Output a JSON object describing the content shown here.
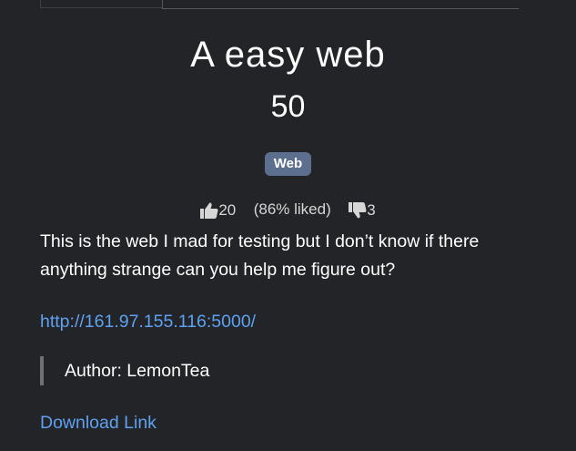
{
  "challenge": {
    "title": "A easy web",
    "points": "50",
    "category_badge": "Web",
    "likes": "20",
    "liked_percent": "(86% liked)",
    "dislikes": "3",
    "description": "This is the web I mad for testing but I don’t know if there anything strange can you help me figure out?",
    "url": "http://161.97.155.116:5000/",
    "author": "Author: LemonTea",
    "download_label": "Download Link"
  },
  "colors": {
    "background": "#232427",
    "badge": "#5c6f8e",
    "link": "#5ea1f0",
    "quote_bar": "#6e7075"
  },
  "icons": {
    "like": "thumbs-up-icon",
    "dislike": "thumbs-down-icon"
  }
}
